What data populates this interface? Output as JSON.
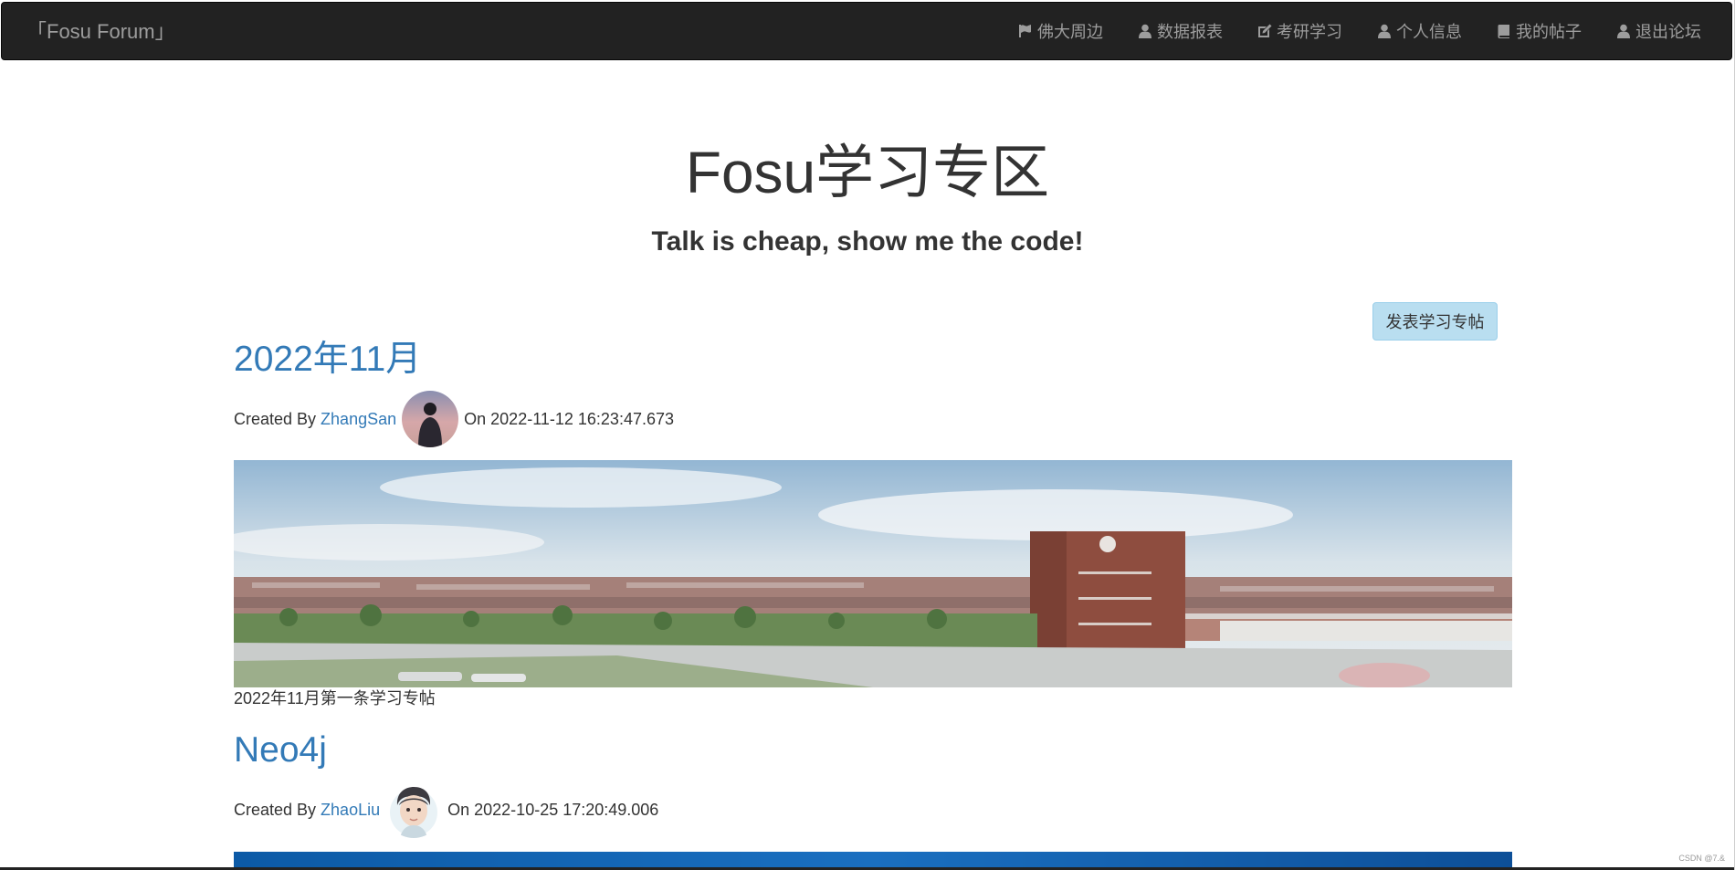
{
  "navbar": {
    "brand": "「Fosu Forum」",
    "items": [
      {
        "label": "佛大周边",
        "icon": "flag-icon"
      },
      {
        "label": "数据报表",
        "icon": "user-icon"
      },
      {
        "label": "考研学习",
        "icon": "edit-icon"
      },
      {
        "label": "个人信息",
        "icon": "user-icon"
      },
      {
        "label": "我的帖子",
        "icon": "book-icon"
      },
      {
        "label": "退出论坛",
        "icon": "user-icon"
      }
    ]
  },
  "header": {
    "title": "Fosu学习专区",
    "subtitle": "Talk is cheap, show me the code!"
  },
  "actions": {
    "new_post_label": "发表学习专帖"
  },
  "posts": [
    {
      "title": "2022年11月",
      "created_by_label": "Created By",
      "author": "ZhangSan",
      "on_label": "On",
      "timestamp": "2022-11-12 16:23:47.673",
      "summary": "2022年11月第一条学习专帖"
    },
    {
      "title": "Neo4j",
      "created_by_label": "Created By",
      "author": "ZhaoLiu",
      "on_label": "On",
      "timestamp": "2022-10-25 17:20:49.006"
    }
  ],
  "watermark": "CSDN @7.&",
  "colors": {
    "navbar_bg": "#222222",
    "nav_text": "#9d9d9d",
    "link": "#337ab7",
    "button_bg": "#b9def0"
  }
}
